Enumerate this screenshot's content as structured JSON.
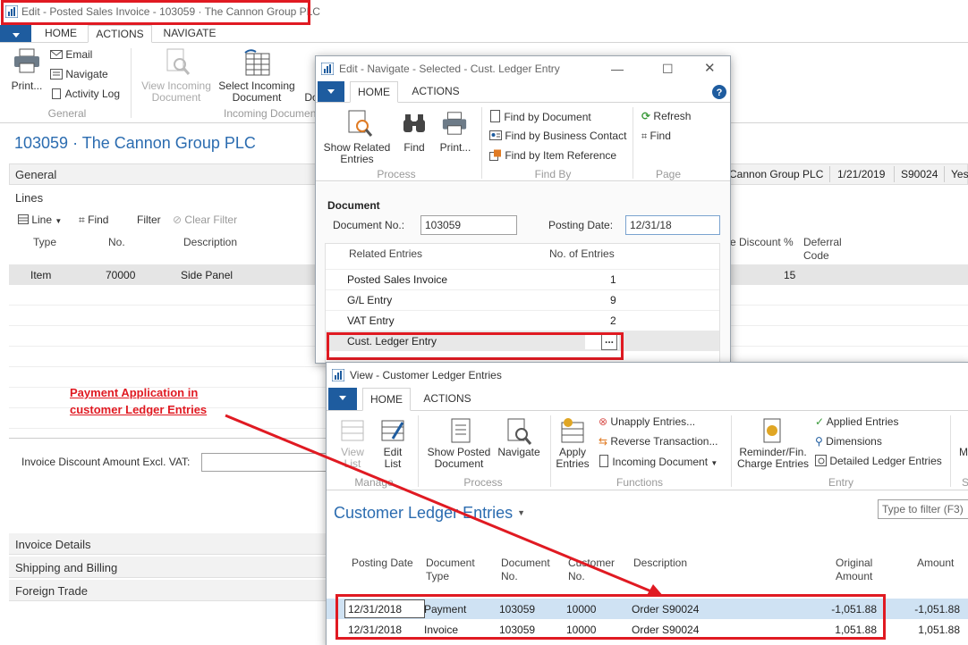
{
  "main": {
    "title": "Edit - Posted Sales Invoice - 103059 · The Cannon Group PLC",
    "tabs": [
      "HOME",
      "ACTIONS",
      "NAVIGATE"
    ],
    "print_label": "Print...",
    "email_label": "Email",
    "navigate_label": "Navigate",
    "activity_log_label": "Activity Log",
    "general_group": "General",
    "view_incoming_label": "View Incoming\nDocument",
    "select_incoming_label": "Select Incoming\nDocument",
    "doc_cut_label": "Do",
    "incoming_group": "Incoming Documen",
    "page_title": "103059 · The Cannon Group PLC",
    "general_section": "General",
    "general_customer": "Cannon Group PLC",
    "general_date": "1/21/2019",
    "general_order": "S90024",
    "general_yes": "Yes",
    "lines_section": "Lines",
    "lines_toolbar": {
      "line": "Line",
      "find": "Find",
      "filter": "Filter",
      "clear_filter": "Clear Filter"
    },
    "lines_headers": {
      "type": "Type",
      "no": "No.",
      "description": "Description",
      "line_discount": "e Discount %",
      "deferral": "Deferral\nCode"
    },
    "line_row": {
      "type": "Item",
      "no": "70000",
      "description": "Side Panel",
      "discount": "15"
    },
    "invoice_discount_label": "Invoice Discount Amount Excl. VAT:",
    "sections": [
      "Invoice Details",
      "Shipping and Billing",
      "Foreign Trade"
    ]
  },
  "annotation": {
    "text_line1": "Payment Application in",
    "text_line2": "customer Ledger Entries",
    "color": "#e01a22"
  },
  "navigate_window": {
    "title": "Edit - Navigate - Selected - Cust. Ledger Entry",
    "tabs": [
      "HOME",
      "ACTIONS"
    ],
    "show_related": "Show Related\nEntries",
    "find": "Find",
    "print": "Print...",
    "process_group": "Process",
    "find_by_document": "Find by Document",
    "find_by_contact": "Find by Business Contact",
    "find_by_item": "Find by Item Reference",
    "find_by_group": "Find By",
    "refresh": "Refresh",
    "find2": "Find",
    "page_group": "Page",
    "document_heading": "Document",
    "document_no_label": "Document No.:",
    "document_no_value": "103059",
    "posting_date_label": "Posting Date:",
    "posting_date_value": "12/31/18",
    "col_related": "Related Entries",
    "col_count": "No. of Entries",
    "rows": [
      {
        "name": "Posted Sales Invoice",
        "count": "1"
      },
      {
        "name": "G/L Entry",
        "count": "9"
      },
      {
        "name": "VAT Entry",
        "count": "2"
      },
      {
        "name": "Cust. Ledger Entry",
        "count": "2"
      }
    ],
    "ellipsis": "..."
  },
  "ledger_window": {
    "title": "View - Customer Ledger Entries",
    "tabs": [
      "HOME",
      "ACTIONS"
    ],
    "view_list": "View\nList",
    "edit_list": "Edit\nList",
    "manage_group": "Manage",
    "show_posted": "Show Posted\nDocument",
    "navigate": "Navigate",
    "process_group": "Process",
    "apply_entries": "Apply\nEntries",
    "unapply": "Unapply Entries...",
    "reverse": "Reverse Transaction...",
    "incoming": "Incoming Document",
    "functions_group": "Functions",
    "reminder": "Reminder/Fin.\nCharge Entries",
    "applied": "Applied Entries",
    "dimensions": "Dimensions",
    "detailed": "Detailed Ledger Entries",
    "entry_group": "Entry",
    "cut_m": "M",
    "cut_s": "S",
    "page_title": "Customer Ledger Entries",
    "filter_placeholder": "Type to filter (F3)",
    "headers": {
      "posting_date": "Posting Date",
      "document_type": "Document\nType",
      "document_no": "Document\nNo.",
      "customer_no": "Customer\nNo.",
      "description": "Description",
      "original_amount": "Original\nAmount",
      "amount": "Amount"
    },
    "rows": [
      {
        "posting_date": "12/31/2018",
        "document_type": "Payment",
        "document_no": "103059",
        "customer_no": "10000",
        "description": "Order S90024",
        "original_amount": "-1,051.88",
        "amount": "-1,051.88"
      },
      {
        "posting_date": "12/31/2018",
        "document_type": "Invoice",
        "document_no": "103059",
        "customer_no": "10000",
        "description": "Order S90024",
        "original_amount": "1,051.88",
        "amount": "1,051.88"
      }
    ]
  },
  "colors": {
    "accent": "#1e5c9f",
    "title_blue": "#2b6cb0",
    "highlight": "#e01a22",
    "selected_row": "#cfe2f3"
  }
}
